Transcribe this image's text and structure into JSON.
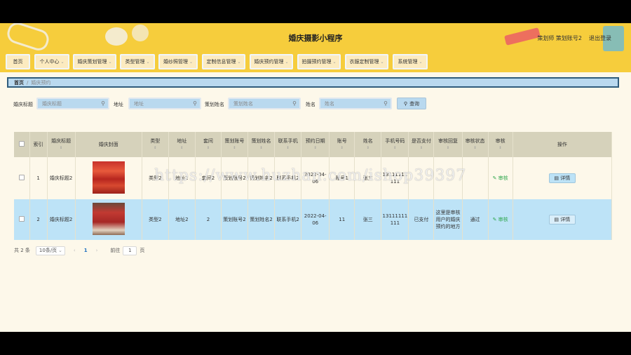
{
  "header": {
    "title": "婚庆摄影小程序",
    "user": "策划师 策划账号2",
    "logout": "退出登录"
  },
  "nav": [
    {
      "label": "首页",
      "has_menu": false
    },
    {
      "label": "个人中心",
      "has_menu": true
    },
    {
      "label": "婚庆策划管理",
      "has_menu": true
    },
    {
      "label": "类型管理",
      "has_menu": true
    },
    {
      "label": "婚纱照管理",
      "has_menu": true
    },
    {
      "label": "定制信息管理",
      "has_menu": true
    },
    {
      "label": "婚庆预约管理",
      "has_menu": true
    },
    {
      "label": "拍摄预约管理",
      "has_menu": true
    },
    {
      "label": "衣服定制管理",
      "has_menu": true
    },
    {
      "label": "系统管理",
      "has_menu": true
    }
  ],
  "breadcrumb": {
    "home": "首页",
    "current": "婚庆预约"
  },
  "search": {
    "f1_label": "婚庆标题",
    "f1_placeholder": "婚庆标题",
    "f2_label": "地址",
    "f2_placeholder": "地址",
    "f3_label": "策划姓名",
    "f3_placeholder": "策划姓名",
    "f4_label": "姓名",
    "f4_placeholder": "姓名",
    "button": "查询"
  },
  "table": {
    "headers": [
      "索引",
      "婚庆标题",
      "婚庆封面",
      "类型",
      "地址",
      "套间",
      "策划账号",
      "策划姓名",
      "联系手机",
      "预约日期",
      "账号",
      "姓名",
      "手机号码",
      "是否支付",
      "审核回复",
      "审核状态",
      "审核",
      "操作"
    ],
    "rows": [
      {
        "index": "1",
        "title": "婚庆标题2",
        "type": "类型2",
        "address": "地址2",
        "suite": "套间2",
        "planner_account": "策划账号2",
        "planner_name": "策划姓名2",
        "phone": "联系手机2",
        "date": "2022-04-06",
        "account": "账号1",
        "name": "张三",
        "mobile": "13111111111",
        "paid": "",
        "reply": "",
        "status": "",
        "review": "审核",
        "action": "详情"
      },
      {
        "index": "2",
        "title": "婚庆标题2",
        "type": "类型2",
        "address": "地址2",
        "suite": "2",
        "planner_account": "策划账号2",
        "planner_name": "策划姓名2",
        "phone": "联系手机2",
        "date": "2022-04-06",
        "account": "11",
        "name": "张三",
        "mobile": "13111111111",
        "paid": "已支付",
        "reply": "这里是审核用户的婚庆预约的地方",
        "status": "通过",
        "review": "审核",
        "action": "详情"
      }
    ]
  },
  "pagination": {
    "total": "共 2 条",
    "page_size": "10条/页",
    "current_page": "1",
    "goto_label": "前往",
    "goto_value": "1",
    "page_unit": "页"
  },
  "watermark": "https://www.huzhan.com/ishop39397",
  "colors": {
    "header": "#f6cd3c",
    "nav_item": "#fcebc0",
    "accent_blue": "#b9d9ef",
    "table_head": "#d6d2bb",
    "row_highlight": "#bde3f7"
  }
}
